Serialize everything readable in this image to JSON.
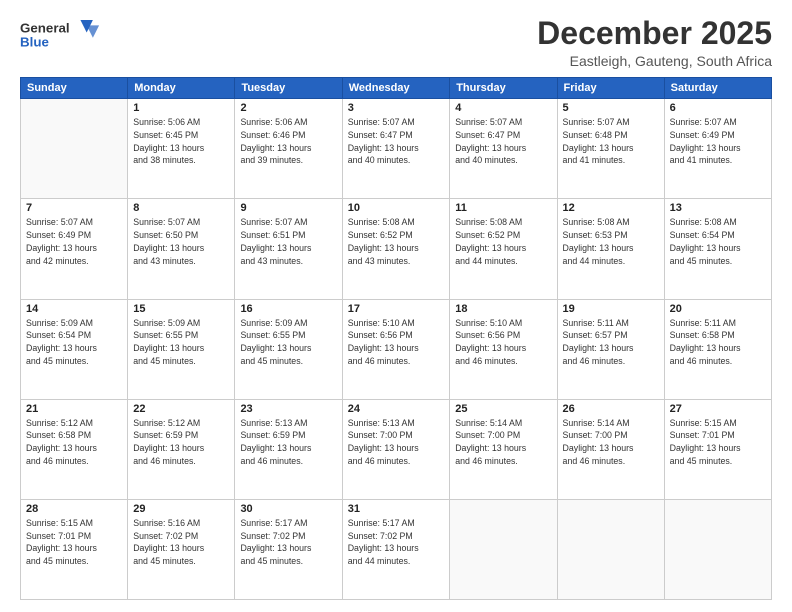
{
  "header": {
    "logo_line1": "General",
    "logo_line2": "Blue",
    "month_title": "December 2025",
    "subtitle": "Eastleigh, Gauteng, South Africa"
  },
  "days_of_week": [
    "Sunday",
    "Monday",
    "Tuesday",
    "Wednesday",
    "Thursday",
    "Friday",
    "Saturday"
  ],
  "weeks": [
    [
      {
        "day": "",
        "detail": ""
      },
      {
        "day": "1",
        "detail": "Sunrise: 5:06 AM\nSunset: 6:45 PM\nDaylight: 13 hours\nand 38 minutes."
      },
      {
        "day": "2",
        "detail": "Sunrise: 5:06 AM\nSunset: 6:46 PM\nDaylight: 13 hours\nand 39 minutes."
      },
      {
        "day": "3",
        "detail": "Sunrise: 5:07 AM\nSunset: 6:47 PM\nDaylight: 13 hours\nand 40 minutes."
      },
      {
        "day": "4",
        "detail": "Sunrise: 5:07 AM\nSunset: 6:47 PM\nDaylight: 13 hours\nand 40 minutes."
      },
      {
        "day": "5",
        "detail": "Sunrise: 5:07 AM\nSunset: 6:48 PM\nDaylight: 13 hours\nand 41 minutes."
      },
      {
        "day": "6",
        "detail": "Sunrise: 5:07 AM\nSunset: 6:49 PM\nDaylight: 13 hours\nand 41 minutes."
      }
    ],
    [
      {
        "day": "7",
        "detail": "Sunrise: 5:07 AM\nSunset: 6:49 PM\nDaylight: 13 hours\nand 42 minutes."
      },
      {
        "day": "8",
        "detail": "Sunrise: 5:07 AM\nSunset: 6:50 PM\nDaylight: 13 hours\nand 43 minutes."
      },
      {
        "day": "9",
        "detail": "Sunrise: 5:07 AM\nSunset: 6:51 PM\nDaylight: 13 hours\nand 43 minutes."
      },
      {
        "day": "10",
        "detail": "Sunrise: 5:08 AM\nSunset: 6:52 PM\nDaylight: 13 hours\nand 43 minutes."
      },
      {
        "day": "11",
        "detail": "Sunrise: 5:08 AM\nSunset: 6:52 PM\nDaylight: 13 hours\nand 44 minutes."
      },
      {
        "day": "12",
        "detail": "Sunrise: 5:08 AM\nSunset: 6:53 PM\nDaylight: 13 hours\nand 44 minutes."
      },
      {
        "day": "13",
        "detail": "Sunrise: 5:08 AM\nSunset: 6:54 PM\nDaylight: 13 hours\nand 45 minutes."
      }
    ],
    [
      {
        "day": "14",
        "detail": "Sunrise: 5:09 AM\nSunset: 6:54 PM\nDaylight: 13 hours\nand 45 minutes."
      },
      {
        "day": "15",
        "detail": "Sunrise: 5:09 AM\nSunset: 6:55 PM\nDaylight: 13 hours\nand 45 minutes."
      },
      {
        "day": "16",
        "detail": "Sunrise: 5:09 AM\nSunset: 6:55 PM\nDaylight: 13 hours\nand 45 minutes."
      },
      {
        "day": "17",
        "detail": "Sunrise: 5:10 AM\nSunset: 6:56 PM\nDaylight: 13 hours\nand 46 minutes."
      },
      {
        "day": "18",
        "detail": "Sunrise: 5:10 AM\nSunset: 6:56 PM\nDaylight: 13 hours\nand 46 minutes."
      },
      {
        "day": "19",
        "detail": "Sunrise: 5:11 AM\nSunset: 6:57 PM\nDaylight: 13 hours\nand 46 minutes."
      },
      {
        "day": "20",
        "detail": "Sunrise: 5:11 AM\nSunset: 6:58 PM\nDaylight: 13 hours\nand 46 minutes."
      }
    ],
    [
      {
        "day": "21",
        "detail": "Sunrise: 5:12 AM\nSunset: 6:58 PM\nDaylight: 13 hours\nand 46 minutes."
      },
      {
        "day": "22",
        "detail": "Sunrise: 5:12 AM\nSunset: 6:59 PM\nDaylight: 13 hours\nand 46 minutes."
      },
      {
        "day": "23",
        "detail": "Sunrise: 5:13 AM\nSunset: 6:59 PM\nDaylight: 13 hours\nand 46 minutes."
      },
      {
        "day": "24",
        "detail": "Sunrise: 5:13 AM\nSunset: 7:00 PM\nDaylight: 13 hours\nand 46 minutes."
      },
      {
        "day": "25",
        "detail": "Sunrise: 5:14 AM\nSunset: 7:00 PM\nDaylight: 13 hours\nand 46 minutes."
      },
      {
        "day": "26",
        "detail": "Sunrise: 5:14 AM\nSunset: 7:00 PM\nDaylight: 13 hours\nand 46 minutes."
      },
      {
        "day": "27",
        "detail": "Sunrise: 5:15 AM\nSunset: 7:01 PM\nDaylight: 13 hours\nand 45 minutes."
      }
    ],
    [
      {
        "day": "28",
        "detail": "Sunrise: 5:15 AM\nSunset: 7:01 PM\nDaylight: 13 hours\nand 45 minutes."
      },
      {
        "day": "29",
        "detail": "Sunrise: 5:16 AM\nSunset: 7:02 PM\nDaylight: 13 hours\nand 45 minutes."
      },
      {
        "day": "30",
        "detail": "Sunrise: 5:17 AM\nSunset: 7:02 PM\nDaylight: 13 hours\nand 45 minutes."
      },
      {
        "day": "31",
        "detail": "Sunrise: 5:17 AM\nSunset: 7:02 PM\nDaylight: 13 hours\nand 44 minutes."
      },
      {
        "day": "",
        "detail": ""
      },
      {
        "day": "",
        "detail": ""
      },
      {
        "day": "",
        "detail": ""
      }
    ]
  ]
}
